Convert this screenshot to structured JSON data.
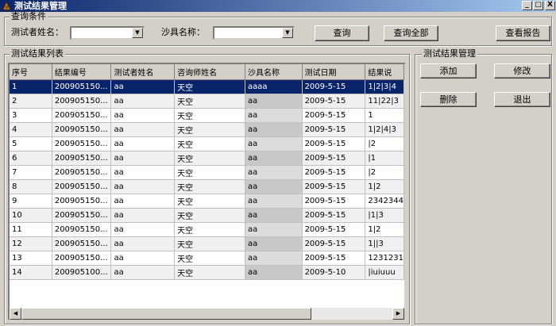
{
  "window": {
    "title": "测试结果管理",
    "min": "_",
    "max": "□",
    "close": "X"
  },
  "query": {
    "legend": "查询条件",
    "tester_label": "测试者姓名：",
    "tester_value": "",
    "tool_label": "沙具名称：",
    "tool_value": "",
    "btn_query": "查询",
    "btn_query_all": "查询全部",
    "btn_report": "查看报告"
  },
  "list": {
    "legend": "测试结果列表",
    "columns": [
      "序号",
      "结果编号",
      "测试者姓名",
      "咨询师姓名",
      "沙具名称",
      "测试日期",
      "结果说"
    ],
    "rows": [
      [
        "1",
        "200905150...",
        "aa",
        "天空",
        "aaaa",
        "2009-5-15",
        "1|2|3|4"
      ],
      [
        "2",
        "200905150...",
        "aa",
        "天空",
        "aa",
        "2009-5-15",
        "11|22|3"
      ],
      [
        "3",
        "200905150...",
        "aa",
        "天空",
        "aa",
        "2009-5-15",
        "1"
      ],
      [
        "4",
        "200905150...",
        "aa",
        "天空",
        "aa",
        "2009-5-15",
        "1|2|4|3"
      ],
      [
        "5",
        "200905150...",
        "aa",
        "天空",
        "aa",
        "2009-5-15",
        "|2"
      ],
      [
        "6",
        "200905150...",
        "aa",
        "天空",
        "aa",
        "2009-5-15",
        "|1"
      ],
      [
        "7",
        "200905150...",
        "aa",
        "天空",
        "aa",
        "2009-5-15",
        "|2"
      ],
      [
        "8",
        "200905150...",
        "aa",
        "天空",
        "aa",
        "2009-5-15",
        "1|2"
      ],
      [
        "9",
        "200905150...",
        "aa",
        "天空",
        "aa",
        "2009-5-15",
        "2342344"
      ],
      [
        "10",
        "200905150...",
        "aa",
        "天空",
        "aa",
        "2009-5-15",
        "|1|3"
      ],
      [
        "11",
        "200905150...",
        "aa",
        "天空",
        "aa",
        "2009-5-15",
        "1|2"
      ],
      [
        "12",
        "200905150...",
        "aa",
        "天空",
        "aa",
        "2009-5-15",
        "1||3"
      ],
      [
        "13",
        "200905150...",
        "aa",
        "天空",
        "aa",
        "2009-5-15",
        "1231231"
      ],
      [
        "14",
        "200905100...",
        "aa",
        "天空",
        "aa",
        "2009-5-10",
        "|iuiuuu"
      ]
    ],
    "selected_row": 0
  },
  "manage": {
    "legend": "测试结果管理",
    "btn_add": "添加",
    "btn_edit": "修改",
    "btn_delete": "删除",
    "btn_exit": "退出"
  },
  "scrollbar": {
    "left_arrow": "◀",
    "right_arrow": "▶"
  },
  "colors": {
    "face": "#d4d0c8",
    "title_start": "#0a246a",
    "title_end": "#a6caf0",
    "selection": "#0a246a"
  }
}
